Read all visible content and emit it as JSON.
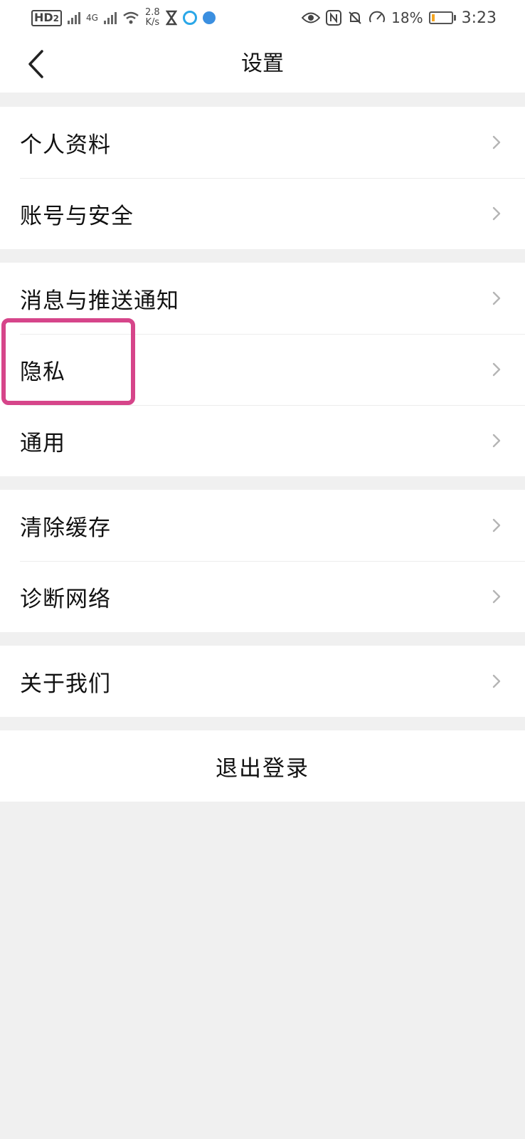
{
  "status_bar": {
    "hd": "HD",
    "hd_sub": "2",
    "network": "4G",
    "speed_value": "2.8",
    "speed_unit": "K/s",
    "battery": "18%",
    "time": "3:23",
    "battery_fill_fraction": 0.18,
    "battery_color": "#f5a623"
  },
  "header": {
    "title": "设置",
    "back_icon": "chevron-left-icon"
  },
  "groups": [
    {
      "items": [
        {
          "label": "个人资料"
        },
        {
          "label": "账号与安全"
        }
      ]
    },
    {
      "items": [
        {
          "label": "消息与推送通知"
        },
        {
          "label": "隐私"
        },
        {
          "label": "通用"
        }
      ]
    },
    {
      "items": [
        {
          "label": "清除缓存"
        },
        {
          "label": "诊断网络"
        }
      ]
    },
    {
      "items": [
        {
          "label": "关于我们"
        }
      ]
    }
  ],
  "logout_label": "退出登录",
  "highlight_color": "#d6458a"
}
